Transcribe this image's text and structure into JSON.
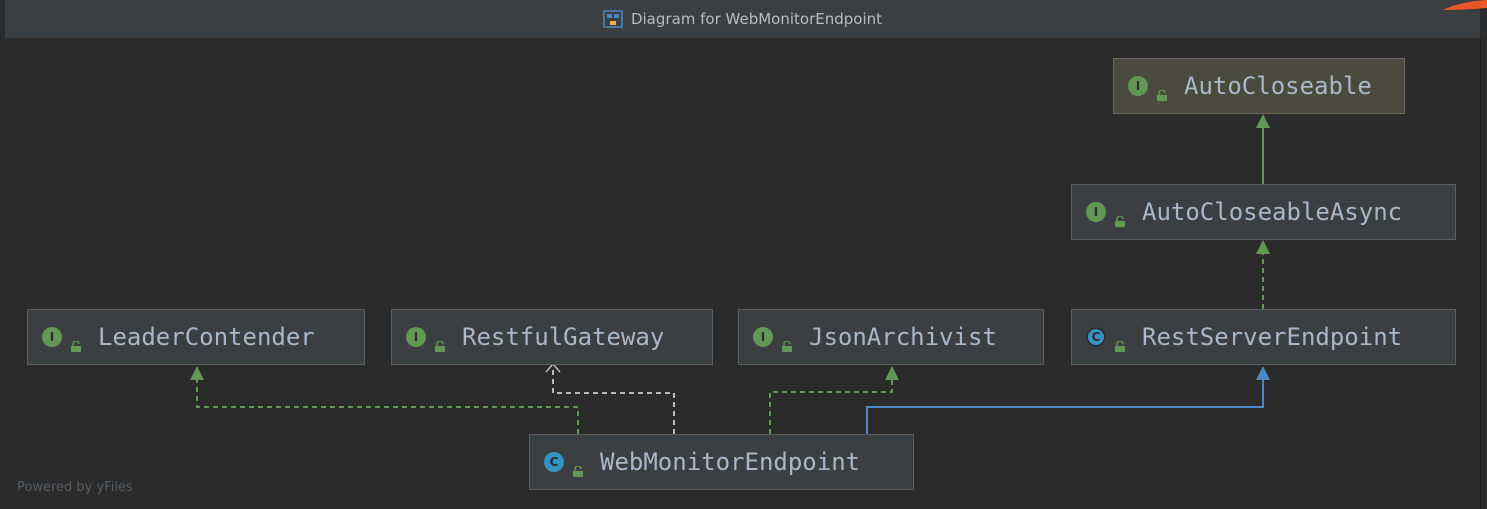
{
  "window": {
    "title": "Diagram for WebMonitorEndpoint"
  },
  "footer": {
    "powered_by": "Powered by yFiles"
  },
  "nodes": {
    "autocloseable": {
      "name": "AutoCloseable",
      "kind": "interface",
      "badge": "I"
    },
    "autocloseableasync": {
      "name": "AutoCloseableAsync",
      "kind": "interface",
      "badge": "I"
    },
    "leadercontender": {
      "name": "LeaderContender",
      "kind": "interface",
      "badge": "I"
    },
    "restfulgateway": {
      "name": "RestfulGateway",
      "kind": "interface",
      "badge": "I"
    },
    "jsonarchivist": {
      "name": "JsonArchivist",
      "kind": "interface",
      "badge": "I"
    },
    "restserverendpoint": {
      "name": "RestServerEndpoint",
      "kind": "abstract-class",
      "badge": "C"
    },
    "webmonitorendpoint": {
      "name": "WebMonitorEndpoint",
      "kind": "class",
      "badge": "C"
    }
  },
  "relations": [
    {
      "from": "AutoCloseableAsync",
      "to": "AutoCloseable",
      "type": "extends"
    },
    {
      "from": "RestServerEndpoint",
      "to": "AutoCloseableAsync",
      "type": "implements"
    },
    {
      "from": "WebMonitorEndpoint",
      "to": "LeaderContender",
      "type": "implements"
    },
    {
      "from": "WebMonitorEndpoint",
      "to": "RestfulGateway",
      "type": "implements"
    },
    {
      "from": "WebMonitorEndpoint",
      "to": "JsonArchivist",
      "type": "implements"
    },
    {
      "from": "WebMonitorEndpoint",
      "to": "RestServerEndpoint",
      "type": "extends"
    }
  ],
  "colors": {
    "implements_edge": "#629755",
    "extends_interface_edge": "#629755",
    "extends_class_edge": "#4a88c7",
    "restful_edge": "#bbbbbb",
    "interface_badge": "#629755",
    "class_badge": "#3592c4",
    "corner_accent": "#e8562a"
  }
}
